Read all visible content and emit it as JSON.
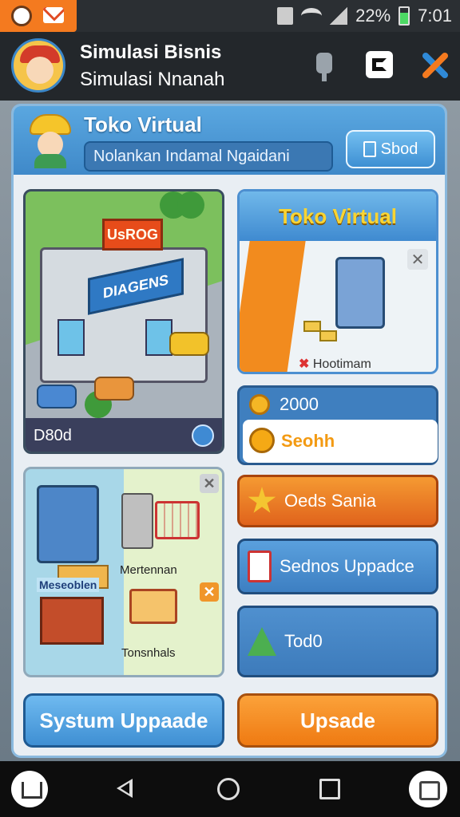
{
  "status_bar": {
    "battery": "22%",
    "time": "7:01",
    "icons": [
      "info-icon",
      "mail-icon",
      "sim-icon",
      "wifi-icon",
      "signal-icon",
      "battery-icon"
    ]
  },
  "app_header": {
    "title": "Simulasi Bisnis",
    "subtitle": "Simulasi Nnanah",
    "icons": [
      "plug-icon",
      "app-icon",
      "tools-icon"
    ]
  },
  "panel": {
    "title": "Toko Virtual",
    "input_value": "Nolankan Indamal Ngaidani",
    "button_label": "Sbod"
  },
  "left_cards": {
    "building_sign_top": "UsROG",
    "building_sign_main": "DIAGENS",
    "building_label": "D80d",
    "market_label_1": "Mertennan",
    "market_label_2": "Tonsnhals",
    "market_sign": "Meseoblen"
  },
  "right_cards": {
    "title": "Toko Virtual",
    "caption": "Hootimam",
    "coins": "2000",
    "coins_button": "Seohh",
    "deals_label": "Oeds Sania",
    "upgrade_label": "Sednos Uppadce",
    "todo_label": "Tod0"
  },
  "bottom": {
    "system_upgrade": "Systum Uppaade",
    "upgrade": "Upsade"
  },
  "colors": {
    "accent_blue": "#3f8ad0",
    "accent_orange": "#f47a1f",
    "brand_yellow": "#f8d433"
  }
}
